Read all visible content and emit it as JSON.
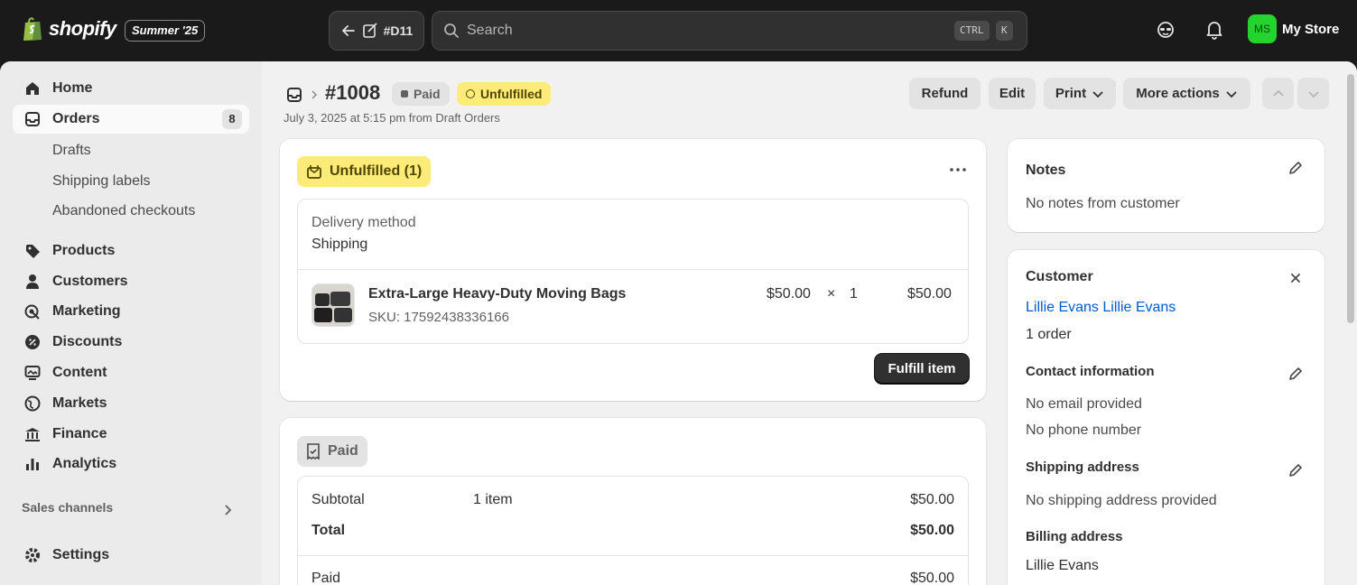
{
  "topbar": {
    "logo_text": "shopify",
    "edition": "Summer '25",
    "back_label": "#D11",
    "search_placeholder": "Search",
    "kbd_ctrl": "CTRL",
    "kbd_k": "K",
    "avatar_initials": "MS",
    "store_name": "My Store"
  },
  "sidebar": {
    "home": "Home",
    "orders": "Orders",
    "orders_count": "8",
    "drafts": "Drafts",
    "shipping_labels": "Shipping labels",
    "abandoned": "Abandoned checkouts",
    "products": "Products",
    "customers": "Customers",
    "marketing": "Marketing",
    "discounts": "Discounts",
    "content": "Content",
    "markets": "Markets",
    "finance": "Finance",
    "analytics": "Analytics",
    "sales_channels": "Sales channels",
    "settings": "Settings"
  },
  "header": {
    "order_number": "#1008",
    "paid_badge": "Paid",
    "unfulfilled_badge": "Unfulfilled",
    "subline": "July 3, 2025 at 5:15 pm from Draft Orders",
    "refund": "Refund",
    "edit": "Edit",
    "print": "Print",
    "more_actions": "More actions"
  },
  "fulfillment": {
    "status": "Unfulfilled (1)",
    "delivery_label": "Delivery method",
    "delivery_value": "Shipping",
    "item_name": "Extra-Large Heavy-Duty Moving Bags",
    "sku": "SKU: 17592438336166",
    "unit_price": "$50.00",
    "times": "×",
    "qty": "1",
    "line_total": "$50.00",
    "fulfill_button": "Fulfill item"
  },
  "payment": {
    "status": "Paid",
    "subtotal_label": "Subtotal",
    "subtotal_items": "1 item",
    "subtotal_value": "$50.00",
    "total_label": "Total",
    "total_value": "$50.00",
    "paid_label": "Paid",
    "paid_value": "$50.00"
  },
  "notes": {
    "title": "Notes",
    "text": "No notes from customer"
  },
  "customer": {
    "title": "Customer",
    "name": "Lillie Evans Lillie Evans",
    "orders": "1 order",
    "contact_title": "Contact information",
    "email": "No email provided",
    "phone": "No phone number",
    "shipping_title": "Shipping address",
    "shipping_text": "No shipping address provided",
    "billing_title": "Billing address",
    "billing_name": "Lillie Evans"
  },
  "colors": {
    "topbar": "#1a1a1a",
    "unfulfilled_bg": "#ffeb78",
    "link": "#005bd3",
    "avatar": "#25d32f"
  }
}
